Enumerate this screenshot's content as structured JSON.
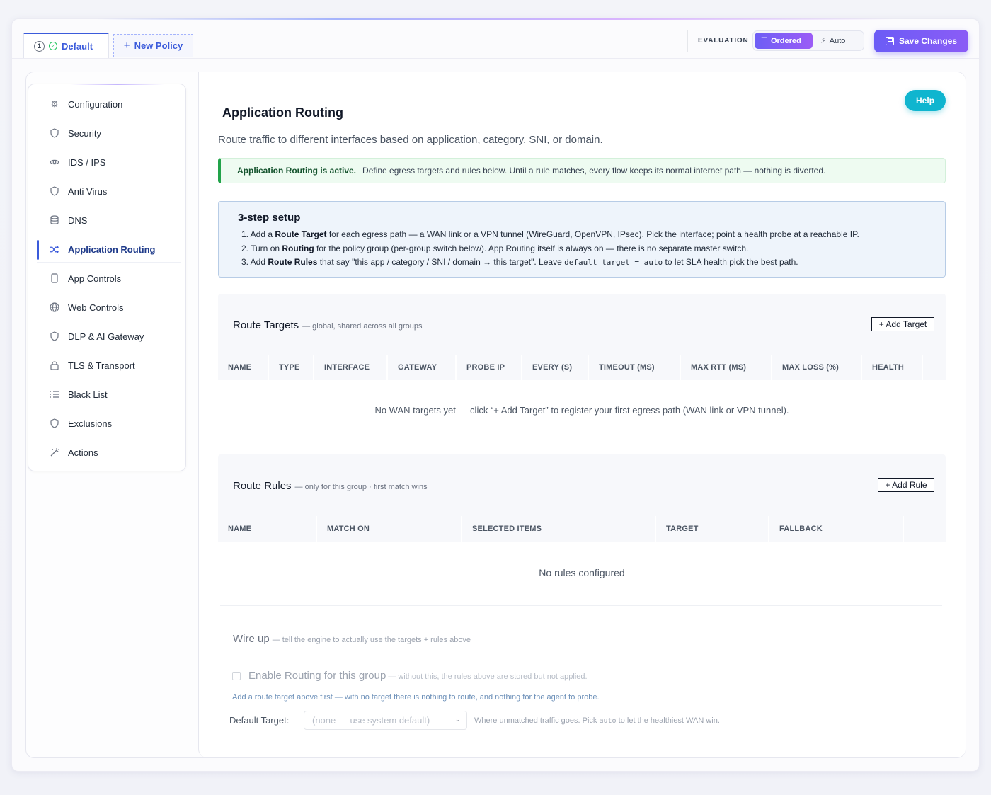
{
  "tabs": {
    "default": {
      "number": "1",
      "label": "Default"
    },
    "new_policy": {
      "label": "New Policy"
    }
  },
  "evaluation": {
    "label": "EVALUATION",
    "options": [
      {
        "label": "Ordered",
        "active": true
      },
      {
        "label": "Auto",
        "active": false
      }
    ]
  },
  "save_button": "Save Changes",
  "help_button": "Help",
  "sidebar": {
    "items": [
      {
        "label": "Configuration",
        "icon": "gear-icon"
      },
      {
        "label": "Security",
        "icon": "shield-icon"
      },
      {
        "label": "IDS / IPS",
        "icon": "eye-icon"
      },
      {
        "label": "Anti Virus",
        "icon": "shield-icon"
      },
      {
        "label": "DNS",
        "icon": "database-icon"
      },
      {
        "label": "Application Routing",
        "icon": "shuffle-icon",
        "active": true
      },
      {
        "label": "App Controls",
        "icon": "phone-icon"
      },
      {
        "label": "Web Controls",
        "icon": "globe-icon"
      },
      {
        "label": "DLP & AI Gateway",
        "icon": "shield-icon"
      },
      {
        "label": "TLS & Transport",
        "icon": "lock-icon"
      },
      {
        "label": "Black List",
        "icon": "list-icon"
      },
      {
        "label": "Exclusions",
        "icon": "shield-icon"
      },
      {
        "label": "Actions",
        "icon": "wand-icon"
      }
    ]
  },
  "page": {
    "title": "Application Routing",
    "description": "Route traffic to different interfaces based on application, category, SNI, or domain."
  },
  "banner": {
    "strong": "Application Routing is active.",
    "text": "Define egress targets and rules below. Until a rule matches, every flow keeps its normal internet path — nothing is diverted."
  },
  "setup": {
    "title": "3-step setup",
    "step1": {
      "prefix": "1. Add a ",
      "bold": "Route Target",
      "rest": " for each egress path — a WAN link or a VPN tunnel (WireGuard, OpenVPN, IPsec). Pick the interface; point a health probe at a reachable IP."
    },
    "step2": {
      "prefix": "2. Turn on ",
      "bold": "Routing",
      "rest": " for the policy group (per-group switch below). App Routing itself is always on — there is no separate master switch."
    },
    "step3": {
      "prefix": "3. Add ",
      "bold": "Route Rules",
      "mid": " that say \"this app / category / SNI / domain → this target\". Leave ",
      "code": "default target = auto",
      "rest": " to let SLA health pick the best path."
    }
  },
  "route_targets": {
    "title": "Route Targets",
    "subtitle": "— global, shared across all groups",
    "add_button": "+ Add Target",
    "columns": [
      "NAME",
      "TYPE",
      "INTERFACE",
      "GATEWAY",
      "PROBE IP",
      "EVERY (S)",
      "TIMEOUT (MS)",
      "MAX RTT (MS)",
      "MAX LOSS (%)",
      "HEALTH",
      ""
    ],
    "empty": "No WAN targets yet — click “+ Add Target” to register your first egress path (WAN link or VPN tunnel)."
  },
  "route_rules": {
    "title": "Route Rules",
    "subtitle": "— only for this group · first match wins",
    "add_button": "+ Add Rule",
    "columns": [
      "NAME",
      "MATCH ON",
      "SELECTED ITEMS",
      "TARGET",
      "FALLBACK",
      ""
    ],
    "empty": "No rules configured"
  },
  "wire_up": {
    "title": "Wire up",
    "subtitle": "— tell the engine to actually use the targets + rules above",
    "enable_label": "Enable Routing for this group",
    "enable_sub": "— without this, the rules above are stored but not applied.",
    "hint": "Add a route target above first — with no target there is nothing to route, and nothing for the agent to probe.",
    "default_target_label": "Default Target:",
    "default_target_value": "(none — use system default)",
    "note_prefix": "Where unmatched traffic goes. Pick ",
    "note_code": "auto",
    "note_suffix": " to let the healthiest WAN win."
  }
}
